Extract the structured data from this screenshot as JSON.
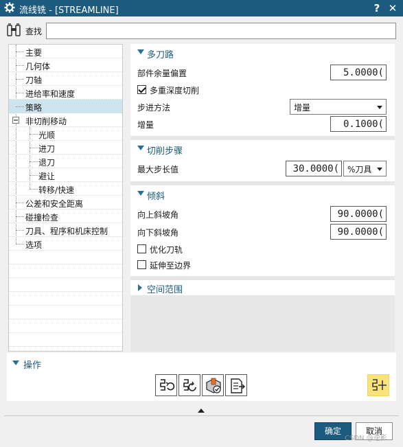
{
  "window": {
    "title": "流线铣 - [STREAMLINE]",
    "help_label": "?",
    "close_label": "✕"
  },
  "search": {
    "label": "查找",
    "value": "",
    "placeholder": ""
  },
  "tree": {
    "items": [
      {
        "label": "主要",
        "level": 0
      },
      {
        "label": "几何体",
        "level": 0
      },
      {
        "label": "刀轴",
        "level": 0
      },
      {
        "label": "进给率和速度",
        "level": 0
      },
      {
        "label": "策略",
        "level": 0,
        "selected": true
      },
      {
        "label": "非切削移动",
        "level": 0,
        "expanded": true
      },
      {
        "label": "光顺",
        "level": 1
      },
      {
        "label": "进刀",
        "level": 1
      },
      {
        "label": "退刀",
        "level": 1
      },
      {
        "label": "避让",
        "level": 1
      },
      {
        "label": "转移/快速",
        "level": 1
      },
      {
        "label": "公差和安全距离",
        "level": 0
      },
      {
        "label": "碰撞检查",
        "level": 0
      },
      {
        "label": "刀具、程序和机床控制",
        "level": 0
      },
      {
        "label": "选项",
        "level": 0
      }
    ],
    "expander_icon": "minus-box-icon"
  },
  "groups": {
    "multi_path": {
      "title": "多刀路",
      "part_stock_offset_label": "部件余量偏置",
      "part_stock_offset_value": "5.0000(",
      "multi_depth_label": "多重深度切削",
      "multi_depth_checked": true,
      "step_method_label": "步进方法",
      "step_method_value": "增量",
      "increment_label": "增量",
      "increment_value": "0.1000("
    },
    "cut_step": {
      "title": "切削步骤",
      "max_step_label": "最大步长值",
      "max_step_value": "30.0000(",
      "max_step_unit": "%刀具"
    },
    "tilt": {
      "title": "倾斜",
      "ramp_up_label": "向上斜坡角",
      "ramp_up_value": "90.0000(",
      "ramp_down_label": "向下斜坡角",
      "ramp_down_value": "90.0000(",
      "optimize_label": "优化刀轨",
      "optimize_checked": false,
      "extend_label": "延伸至边界",
      "extend_checked": false
    },
    "space_range": {
      "title": "空间范围",
      "collapsed": true
    }
  },
  "operations": {
    "title": "操作",
    "buttons": [
      "generate-icon",
      "replay-icon",
      "verify-icon",
      "list-icon",
      "edit-display-icon"
    ]
  },
  "dialog": {
    "ok_label": "确定",
    "cancel_label": "取消"
  },
  "watermark": "CSDN @逆影",
  "colors": {
    "accent": "#1c5a7f",
    "highlight": "#f8e27a",
    "selection": "#cde4ef"
  }
}
